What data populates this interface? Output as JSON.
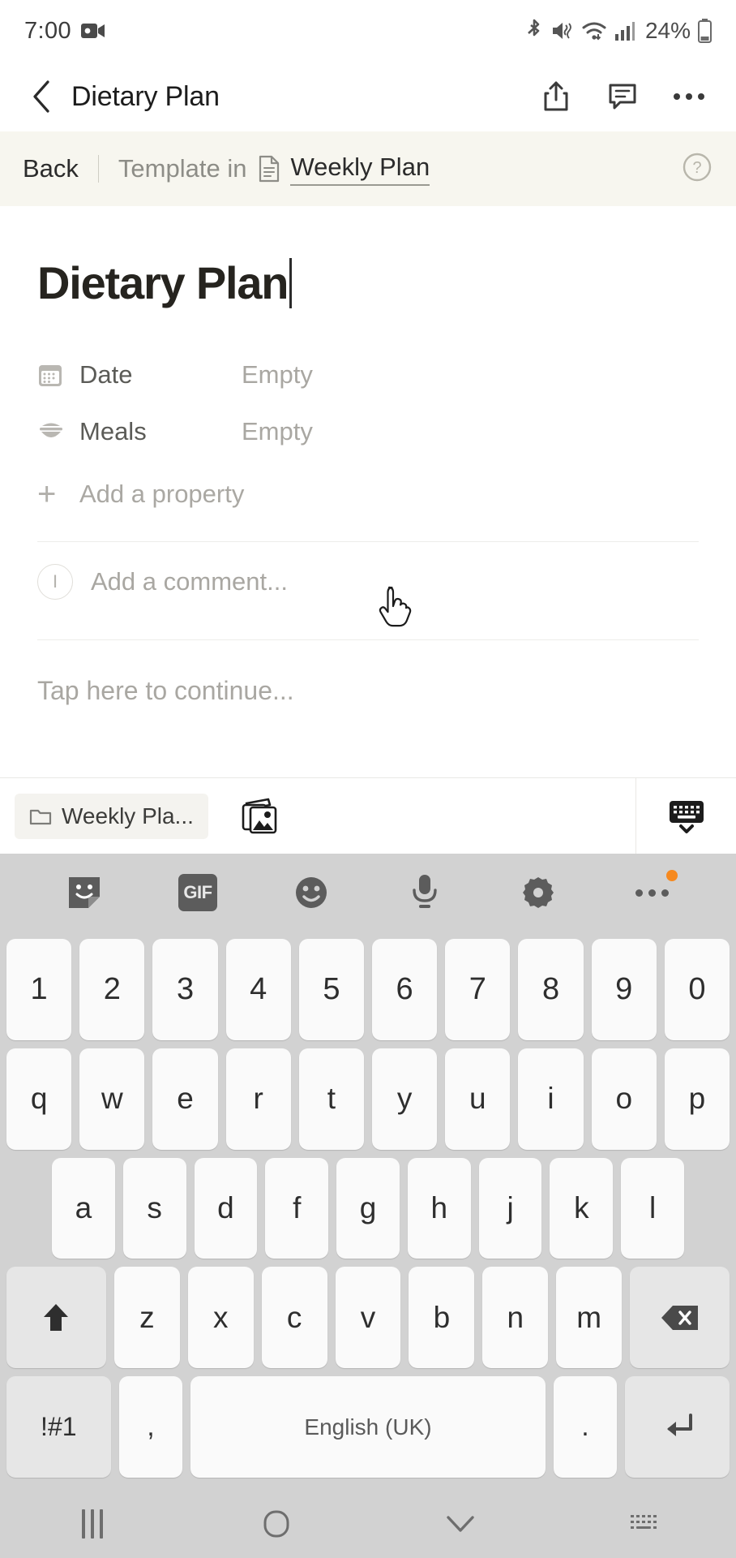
{
  "status_bar": {
    "time": "7:00",
    "battery_percent": "24%",
    "icons": [
      "video-record-icon",
      "bluetooth-icon",
      "mute-vibrate-icon",
      "wifi-icon",
      "signal-icon",
      "battery-icon"
    ]
  },
  "header": {
    "back_icon": "chevron-left-icon",
    "title": "Dietary Plan",
    "actions": [
      "share-icon",
      "comment-icon",
      "more-options-icon"
    ]
  },
  "breadcrumb": {
    "back_label": "Back",
    "template_label": "Template in",
    "page_icon": "page-document-icon",
    "page_label": "Weekly Plan",
    "help_icon": "help-circle-icon",
    "background": "#f7f6ef"
  },
  "page": {
    "title": "Dietary Plan",
    "properties": [
      {
        "icon": "calendar-icon",
        "name": "Date",
        "value": "Empty"
      },
      {
        "icon": "bowl-meal-icon",
        "name": "Meals",
        "value": "Empty"
      }
    ],
    "add_property_label": "Add a property",
    "add_property_icon": "plus-icon",
    "comment": {
      "avatar_initial": "I",
      "placeholder": "Add a comment..."
    },
    "continue_placeholder": "Tap here to continue..."
  },
  "app_toolbar": {
    "chip_icon": "folder-icon",
    "chip_label": "Weekly Pla...",
    "gallery_icon": "gallery-images-icon",
    "hide_keyboard_icon": "hide-keyboard-icon"
  },
  "keyboard": {
    "toolbar": [
      {
        "icon": "sticker-icon",
        "badge": false
      },
      {
        "icon": "gif-icon",
        "label": "GIF",
        "badge": false
      },
      {
        "icon": "emoji-smiley-icon",
        "badge": false
      },
      {
        "icon": "microphone-icon",
        "badge": false
      },
      {
        "icon": "settings-gear-icon",
        "badge": false
      },
      {
        "icon": "more-horizontal-icon",
        "badge": true
      }
    ],
    "badge_color": "#f6891f",
    "row_numbers": [
      "1",
      "2",
      "3",
      "4",
      "5",
      "6",
      "7",
      "8",
      "9",
      "0"
    ],
    "row_qwerty": [
      "q",
      "w",
      "e",
      "r",
      "t",
      "y",
      "u",
      "i",
      "o",
      "p"
    ],
    "row_asdf": [
      "a",
      "s",
      "d",
      "f",
      "g",
      "h",
      "j",
      "k",
      "l"
    ],
    "row_zxcv": [
      "z",
      "x",
      "c",
      "v",
      "b",
      "n",
      "m"
    ],
    "shift_icon": "shift-arrow-icon",
    "backspace_icon": "backspace-icon",
    "symbols_label": "!#1",
    "comma_label": ",",
    "space_label": "English (UK)",
    "period_label": ".",
    "enter_icon": "enter-return-icon"
  },
  "nav_bar": {
    "recent_icon": "recent-apps-icon",
    "home_icon": "home-icon",
    "back_icon": "chevron-down-icon",
    "keyboard_switch_icon": "keyboard-switch-icon"
  }
}
